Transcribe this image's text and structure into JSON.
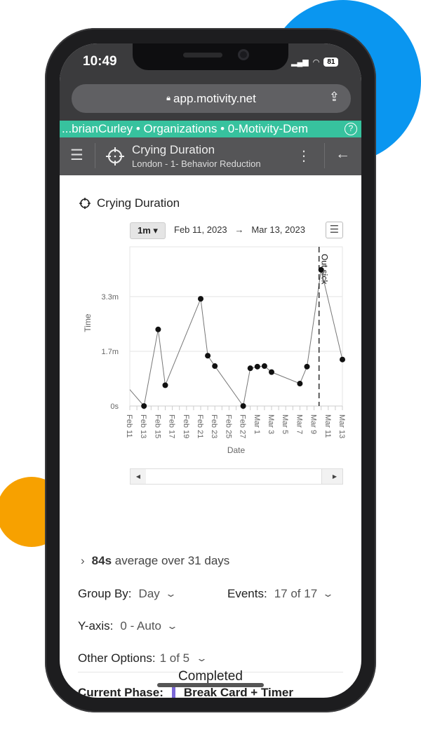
{
  "status_bar": {
    "time": "10:49",
    "battery": "81"
  },
  "browser": {
    "url": "app.motivity.net"
  },
  "breadcrumb": "...brianCurley • Organizations • 0-Motivity-Dem",
  "app_bar": {
    "title": "Crying Duration",
    "subtitle": "London - 1- Behavior Reduction"
  },
  "graph": {
    "title": "Crying Duration",
    "range_button": "1m ▾",
    "start_date": "Feb 11, 2023",
    "arrow": "→",
    "end_date": "Mar 13, 2023"
  },
  "chart_data": {
    "type": "line",
    "xlabel": "Date",
    "ylabel": "Time",
    "x_ticks": [
      "Feb 11",
      "Feb 13",
      "Feb 15",
      "Feb 17",
      "Feb 19",
      "Feb 21",
      "Feb 23",
      "Feb 25",
      "Feb 27",
      "Mar 1",
      "Mar 3",
      "Mar 5",
      "Mar 7",
      "Mar 9",
      "Mar 11",
      "Mar 13"
    ],
    "xlim": [
      "2023-02-11",
      "2023-03-13"
    ],
    "y_ticks": [
      {
        "value_s": 0,
        "label": "0s"
      },
      {
        "value_s": 100,
        "label": "1.7m"
      },
      {
        "value_s": 200,
        "label": "3.3m"
      }
    ],
    "ylim_s": [
      0,
      290
    ],
    "grid": true,
    "points": [
      {
        "date": "2023-02-10",
        "value_s": 45
      },
      {
        "date": "2023-02-13",
        "value_s": 0
      },
      {
        "date": "2023-02-15",
        "value_s": 140
      },
      {
        "date": "2023-02-16",
        "value_s": 38
      },
      {
        "date": "2023-02-21",
        "value_s": 196
      },
      {
        "date": "2023-02-22",
        "value_s": 92
      },
      {
        "date": "2023-02-23",
        "value_s": 73
      },
      {
        "date": "2023-02-27",
        "value_s": 0
      },
      {
        "date": "2023-02-28",
        "value_s": 69
      },
      {
        "date": "2023-03-01",
        "value_s": 72
      },
      {
        "date": "2023-03-02",
        "value_s": 73
      },
      {
        "date": "2023-03-03",
        "value_s": 62
      },
      {
        "date": "2023-03-07",
        "value_s": 41
      },
      {
        "date": "2023-03-08",
        "value_s": 72
      },
      {
        "date": "2023-03-10",
        "value_s": 249
      },
      {
        "date": "2023-03-13",
        "value_s": 85
      }
    ],
    "annotations": [
      {
        "date": "2023-03-10",
        "label": "Out sick",
        "style": "dashed"
      }
    ]
  },
  "summary": {
    "value": "84s",
    "text": "average over 31 days"
  },
  "options": {
    "group_by": {
      "label": "Group By:",
      "value": "Day"
    },
    "events": {
      "label": "Events:",
      "value": "17 of 17"
    },
    "y_axis": {
      "label": "Y-axis:",
      "value": "0 - Auto"
    },
    "other": {
      "label": "Other Options:",
      "value": "1 of 5"
    }
  },
  "phase": {
    "label": "Current Phase:",
    "value": "Break Card + Timer",
    "color": "#7b68d8"
  },
  "footer": {
    "completed": "Completed"
  },
  "colors": {
    "teal": "#37c29e",
    "blue_circle": "#0a96f0",
    "orange_circle": "#f7a100"
  }
}
